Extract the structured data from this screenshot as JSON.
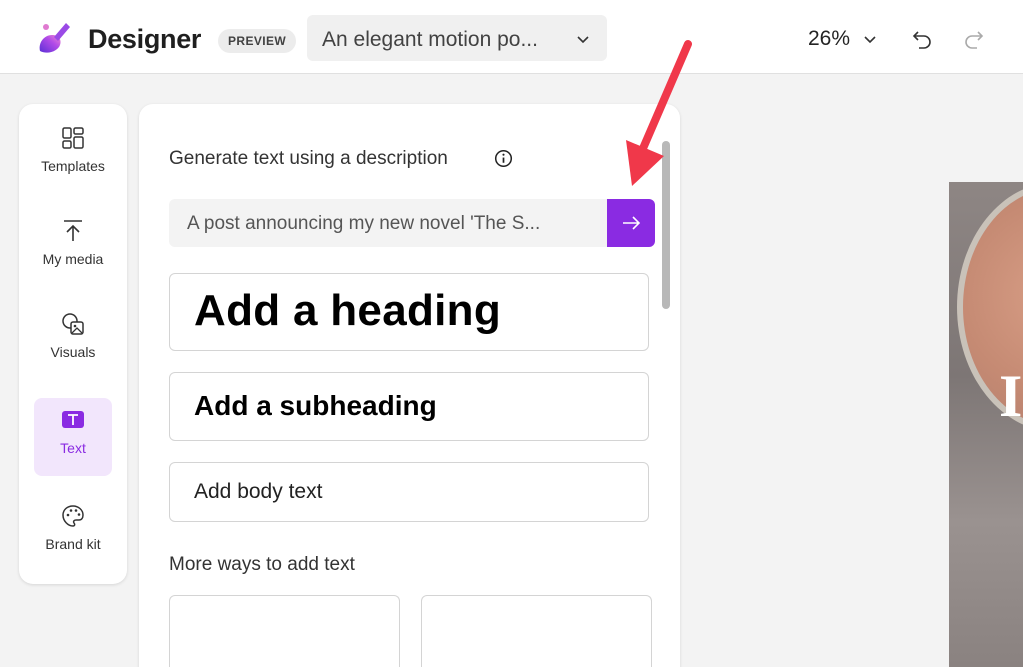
{
  "header": {
    "app_name": "Designer",
    "preview_badge": "PREVIEW",
    "design_title": "An elegant motion po...",
    "zoom": "26%"
  },
  "rail": {
    "items": [
      {
        "label": "Templates",
        "icon": "templates-icon"
      },
      {
        "label": "My media",
        "icon": "upload-icon"
      },
      {
        "label": "Visuals",
        "icon": "visuals-icon"
      },
      {
        "label": "Text",
        "icon": "text-icon",
        "active": true
      },
      {
        "label": "Brand kit",
        "icon": "palette-icon"
      }
    ]
  },
  "panel": {
    "generate_heading": "Generate text using a description",
    "prompt_value": "A post announcing my new novel 'The S...",
    "add_heading": "Add a heading",
    "add_subheading": "Add a subheading",
    "add_body": "Add body text",
    "more_ways": "More ways to add text"
  },
  "colors": {
    "accent": "#8a2be2",
    "annotation_arrow": "#f0384a"
  }
}
